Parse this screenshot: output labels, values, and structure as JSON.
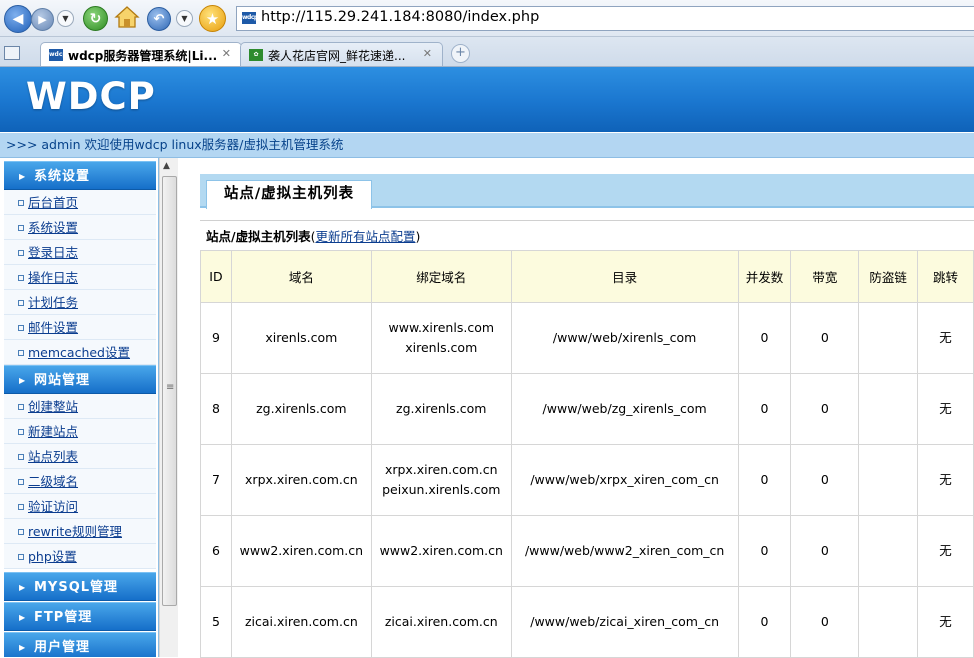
{
  "browser": {
    "url": "http://115.29.241.184:8080/index.php",
    "favicon_text": "wdcp",
    "tabs": [
      {
        "title": "wdcp服务器管理系统|Li...",
        "active": true
      },
      {
        "title": "袭人花店官网_鲜花速递...",
        "active": false
      }
    ],
    "icons": [
      "back-icon",
      "forward-icon",
      "refresh-icon",
      "home-icon",
      "undo-icon",
      "favorites-star-icon",
      "new-tab-icon",
      "close-icon"
    ]
  },
  "app": {
    "logo": "WDCP",
    "welcome": ">>> admin 欢迎使用wdcp linux服务器/虚拟主机管理系统"
  },
  "sidebar": {
    "sections": [
      {
        "label": "系统设置",
        "items": [
          "后台首页",
          "系统设置",
          "登录日志",
          "操作日志",
          "计划任务",
          "邮件设置",
          "memcached设置"
        ]
      },
      {
        "label": "网站管理",
        "items": [
          "创建整站",
          "新建站点",
          "站点列表",
          "二级域名",
          "验证访问",
          "rewrite规则管理",
          "php设置"
        ]
      },
      {
        "label": "MYSQL管理",
        "items": []
      },
      {
        "label": "FTP管理",
        "items": []
      },
      {
        "label": "用户管理",
        "items": []
      }
    ]
  },
  "main": {
    "page_tab": "站点/虚拟主机列表",
    "list_title": "站点/虚拟主机列表",
    "open_paren": "(",
    "update_link": "更新所有站点配置",
    "close_paren": ")",
    "columns": [
      "ID",
      "域名",
      "绑定域名",
      "目录",
      "并发数",
      "带宽",
      "防盗链",
      "跳转"
    ],
    "rows": [
      {
        "id": "9",
        "domain": "xirenls.com",
        "bind": [
          "www.xirenls.com",
          "xirenls.com"
        ],
        "dir": "/www/web/xirenls_com",
        "conn": "0",
        "bw": "0",
        "anti": "",
        "redirect": "无"
      },
      {
        "id": "8",
        "domain": "zg.xirenls.com",
        "bind": [
          "zg.xirenls.com"
        ],
        "dir": "/www/web/zg_xirenls_com",
        "conn": "0",
        "bw": "0",
        "anti": "",
        "redirect": "无"
      },
      {
        "id": "7",
        "domain": "xrpx.xiren.com.cn",
        "bind": [
          "xrpx.xiren.com.cn",
          "peixun.xirenls.com"
        ],
        "dir": "/www/web/xrpx_xiren_com_cn",
        "conn": "0",
        "bw": "0",
        "anti": "",
        "redirect": "无"
      },
      {
        "id": "6",
        "domain": "www2.xiren.com.cn",
        "bind": [
          "www2.xiren.com.cn"
        ],
        "dir": "/www/web/www2_xiren_com_cn",
        "conn": "0",
        "bw": "0",
        "anti": "",
        "redirect": "无"
      },
      {
        "id": "5",
        "domain": "zicai.xiren.com.cn",
        "bind": [
          "zicai.xiren.com.cn"
        ],
        "dir": "/www/web/zicai_xiren_com_cn",
        "conn": "0",
        "bw": "0",
        "anti": "",
        "redirect": "无"
      }
    ]
  }
}
